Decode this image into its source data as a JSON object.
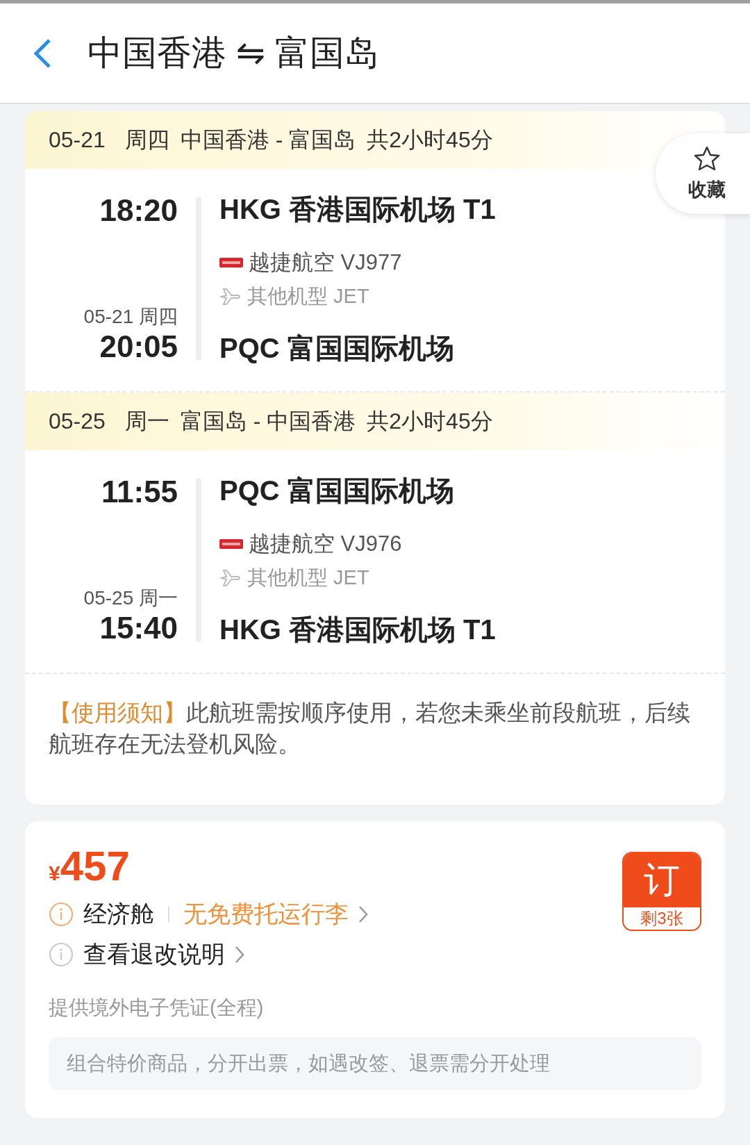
{
  "header": {
    "title": "中国香港 ⇋ 富国岛"
  },
  "favorite": {
    "label": "收藏"
  },
  "segments": [
    {
      "date": "05-21",
      "weekday": "周四",
      "route": "中国香港 - 富国岛",
      "duration": "共2小时45分",
      "depart_time": "18:20",
      "depart_airport": "HKG 香港国际机场 T1",
      "airline": "越捷航空 VJ977",
      "aircraft": "其他机型 JET",
      "arrive_date": "05-21 周四",
      "arrive_time": "20:05",
      "arrive_airport": "PQC 富国国际机场"
    },
    {
      "date": "05-25",
      "weekday": "周一",
      "route": "富国岛 - 中国香港",
      "duration": "共2小时45分",
      "depart_time": "11:55",
      "depart_airport": "PQC 富国国际机场",
      "airline": "越捷航空 VJ976",
      "aircraft": "其他机型 JET",
      "arrive_date": "05-25 周一",
      "arrive_time": "15:40",
      "arrive_airport": "HKG 香港国际机场 T1"
    }
  ],
  "notice": {
    "tag": "【使用须知】",
    "text": "此航班需按顺序使用，若您未乘坐前段航班，后续航班存在无法登机风险。"
  },
  "price": {
    "currency": "¥",
    "amount": "457"
  },
  "cabin": "经济舱",
  "baggage": "无免费托运行李",
  "refund_link": "查看退改说明",
  "book": {
    "label": "订",
    "remaining": "剩3张"
  },
  "voucher": "提供境外电子凭证(全程)",
  "combo_note": "组合特价商品，分开出票，如遇改签、退票需分开处理"
}
